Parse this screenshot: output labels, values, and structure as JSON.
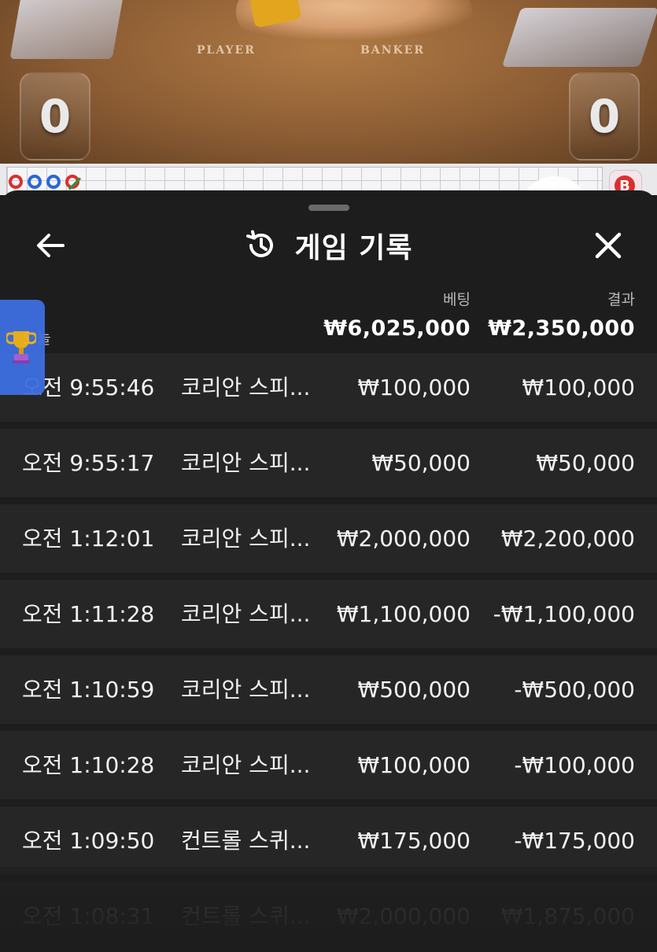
{
  "game_stage": {
    "player_label": "PLAYER",
    "banker_label": "BANKER",
    "player_score": "0",
    "banker_score": "0"
  },
  "roadmap": {
    "badge_letter": "B"
  },
  "header": {
    "title": "게임 기록",
    "back_icon": "arrow-left-icon",
    "history_icon": "history-icon",
    "close_icon": "close-icon"
  },
  "columns": {
    "bet": "베팅",
    "result": "결과"
  },
  "summary": {
    "label": "오늘",
    "total_bet": "₩6,025,000",
    "total_result": "₩2,350,000"
  },
  "records": [
    {
      "time": "오전 9:55:46",
      "game": "코리안 스피...",
      "bet": "₩100,000",
      "result": "₩100,000"
    },
    {
      "time": "오전 9:55:17",
      "game": "코리안 스피...",
      "bet": "₩50,000",
      "result": "₩50,000"
    },
    {
      "time": "오전 1:12:01",
      "game": "코리안 스피...",
      "bet": "₩2,000,000",
      "result": "₩2,200,000"
    },
    {
      "time": "오전 1:11:28",
      "game": "코리안 스피...",
      "bet": "₩1,100,000",
      "result": "-₩1,100,000"
    },
    {
      "time": "오전 1:10:59",
      "game": "코리안 스피...",
      "bet": "₩500,000",
      "result": "-₩500,000"
    },
    {
      "time": "오전 1:10:28",
      "game": "코리안 스피...",
      "bet": "₩100,000",
      "result": "-₩100,000"
    },
    {
      "time": "오전 1:09:50",
      "game": "컨트롤 스퀴...",
      "bet": "₩175,000",
      "result": "-₩175,000"
    },
    {
      "time": "오전 1:08:31",
      "game": "컨트롤 스퀴...",
      "bet": "₩2,000,000",
      "result": "₩1,875,000"
    }
  ],
  "side_tab": {
    "icon": "trophy-icon"
  },
  "colors": {
    "sheet_bg": "#1d1d1d",
    "row_bg": "#262626",
    "accent_blue": "#3d6fe0"
  }
}
